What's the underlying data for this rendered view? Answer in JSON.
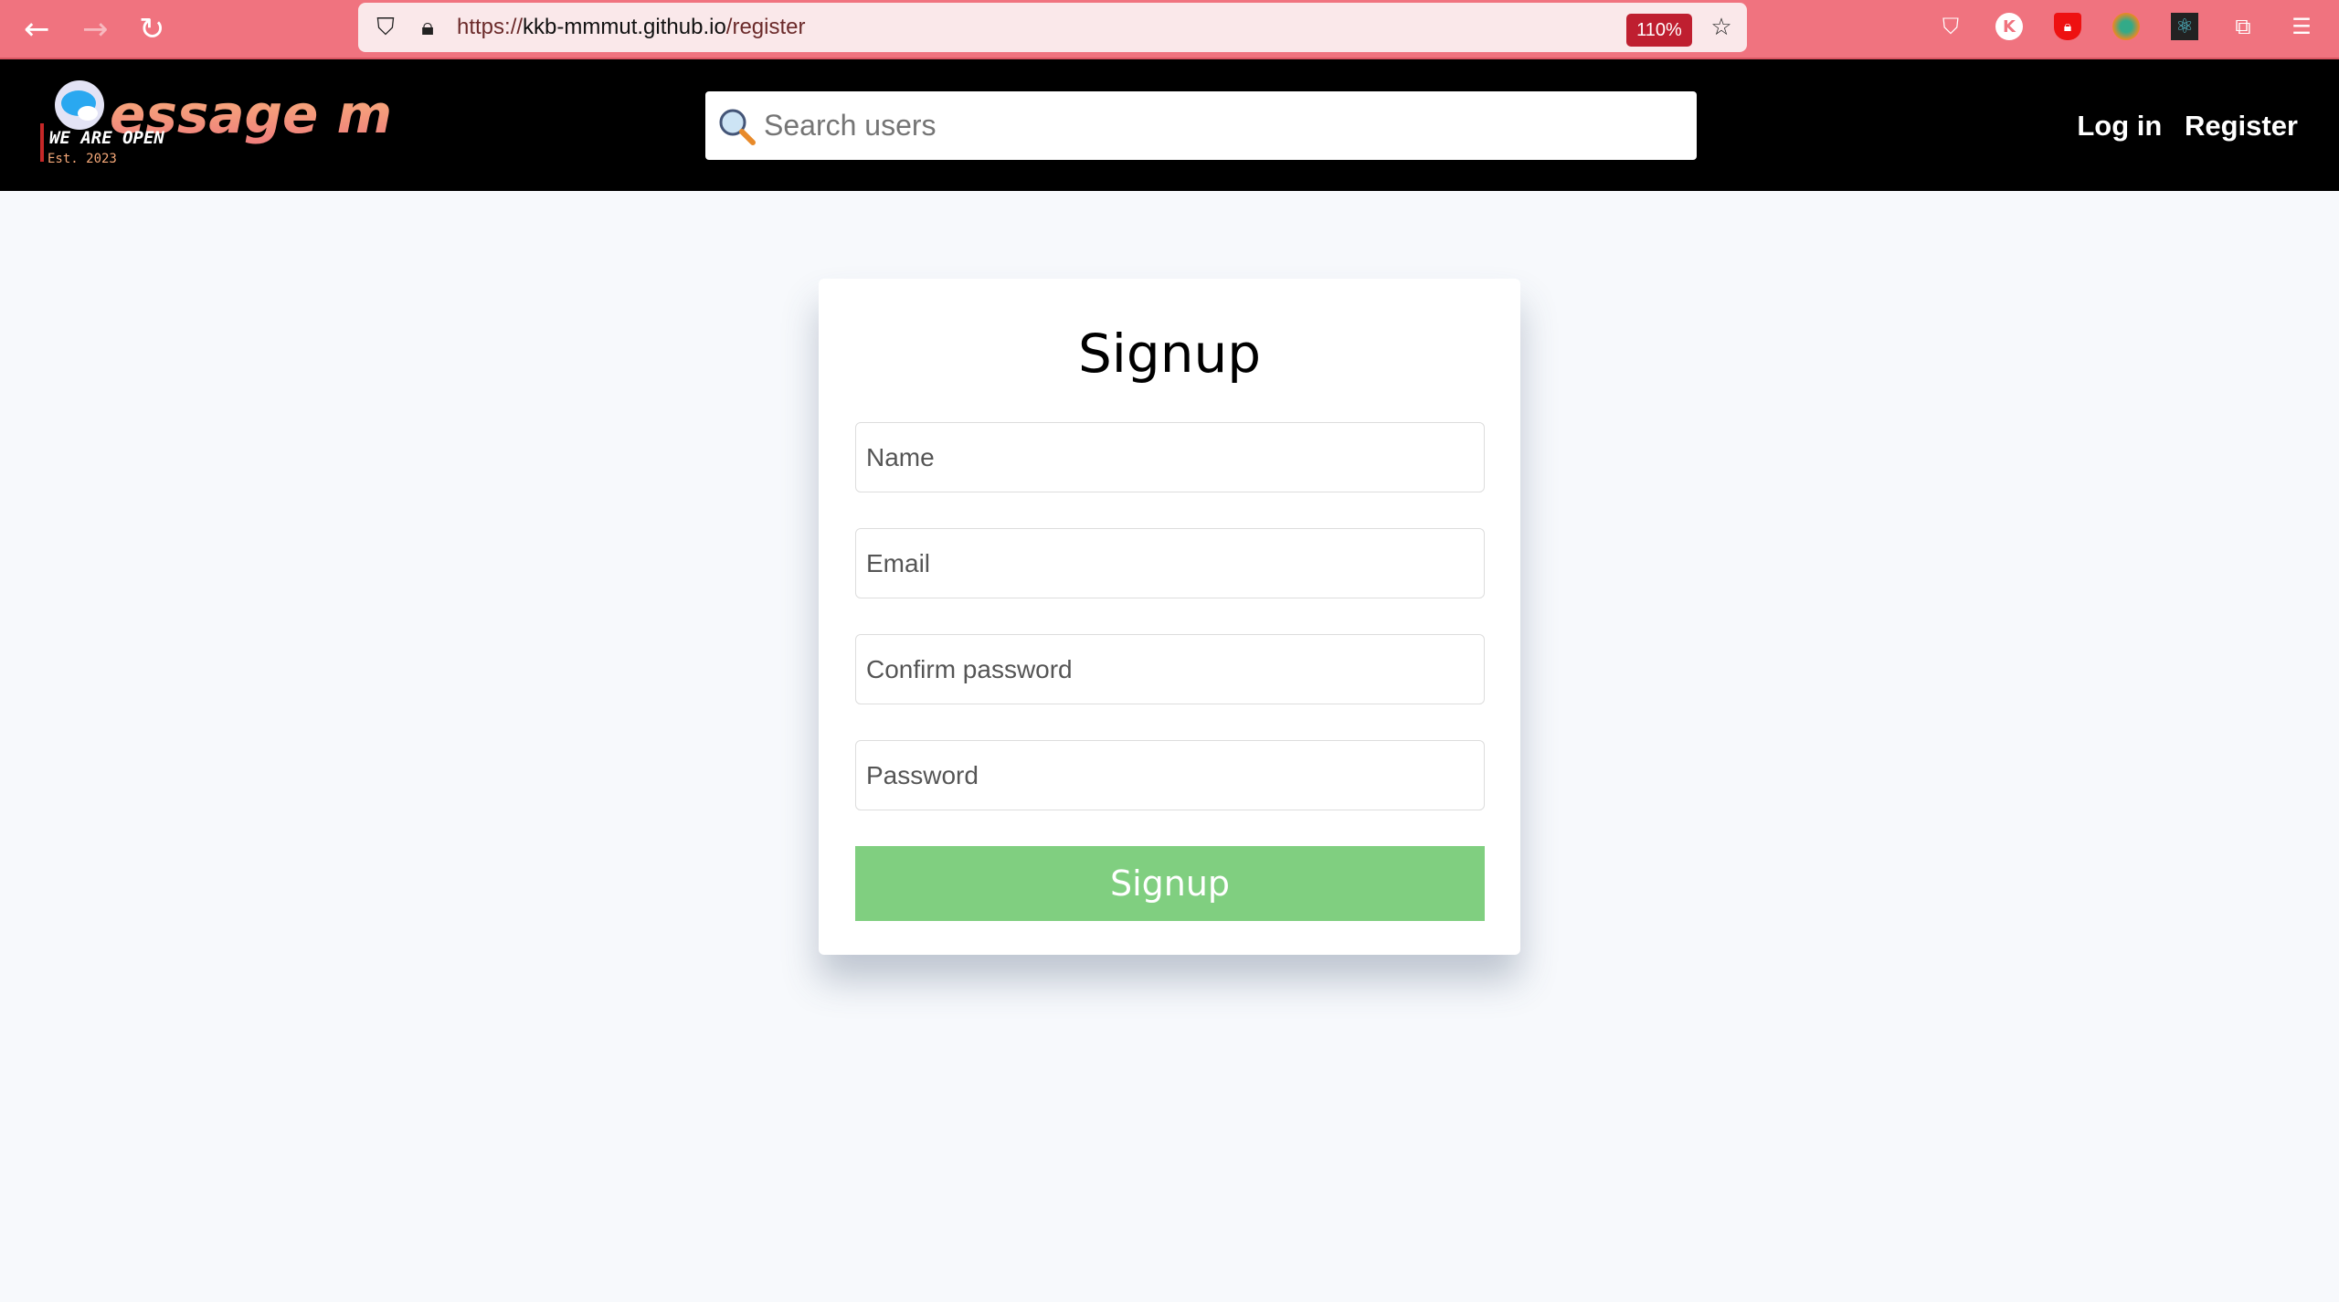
{
  "browser": {
    "url_prefix": "https://",
    "url_host": "kkb-mmmut.github.io",
    "url_path": "/register",
    "zoom": "110%",
    "accent": "#f0737f"
  },
  "header": {
    "logo_text": "essage me",
    "logo_tagline": "WE ARE OPEN",
    "logo_est": "Est. 2023",
    "search_placeholder": "Search users",
    "login": "Log in",
    "register": "Register"
  },
  "form": {
    "title": "Signup",
    "fields": [
      {
        "placeholder": "Name"
      },
      {
        "placeholder": "Email"
      },
      {
        "placeholder": "Confirm password"
      },
      {
        "placeholder": "Password"
      }
    ],
    "submit": "Signup",
    "button_color": "#80cf80"
  }
}
